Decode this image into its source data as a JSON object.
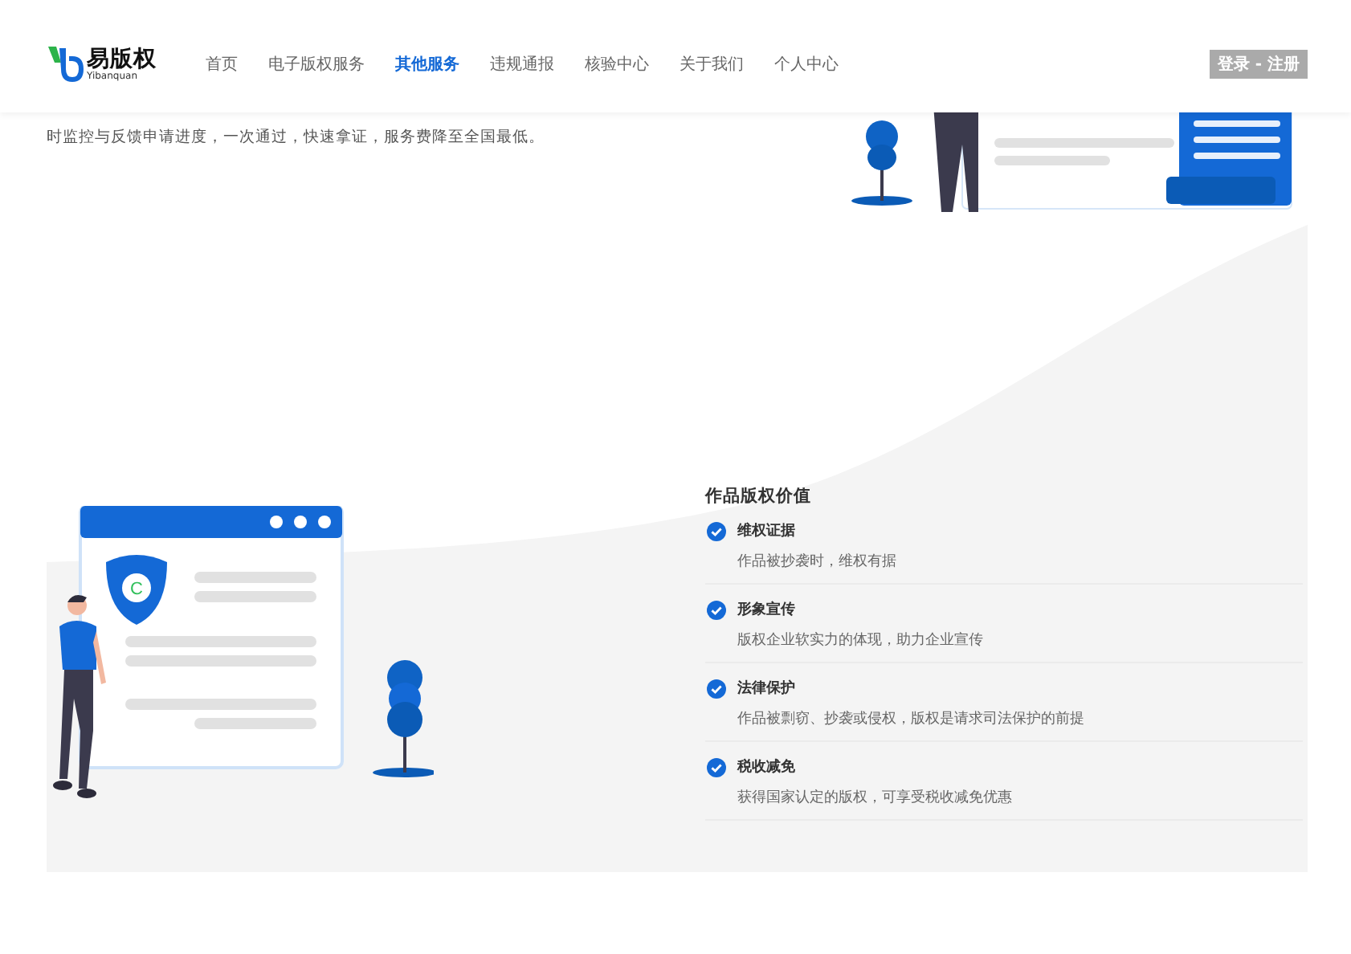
{
  "brand": {
    "name": "易版权",
    "subtitle": "Yibanquan"
  },
  "nav": [
    {
      "label": "首页",
      "selected": false
    },
    {
      "label": "电子版权服务",
      "selected": false
    },
    {
      "label": "其他服务",
      "selected": true
    },
    {
      "label": "违规通报",
      "selected": false
    },
    {
      "label": "核验中心",
      "selected": false
    },
    {
      "label": "关于我们",
      "selected": false
    },
    {
      "label": "个人中心",
      "selected": false
    }
  ],
  "login_button": "登录 - 注册",
  "intro_text": "时监控与反馈申请进度，一次通过，快速拿证，服务费降至全国最低。",
  "illustration": {
    "shield_letter": "C"
  },
  "values": {
    "title": "作品版权价值",
    "items": [
      {
        "title": "维权证据",
        "description": "作品被抄袭时，维权有据"
      },
      {
        "title": "形象宣传",
        "description": "版权企业软实力的体现，助力企业宣传"
      },
      {
        "title": "法律保护",
        "description": "作品被剽窃、抄袭或侵权，版权是请求司法保护的前提"
      },
      {
        "title": "税收减免",
        "description": "获得国家认定的版权，可享受税收减免优惠"
      }
    ]
  }
}
